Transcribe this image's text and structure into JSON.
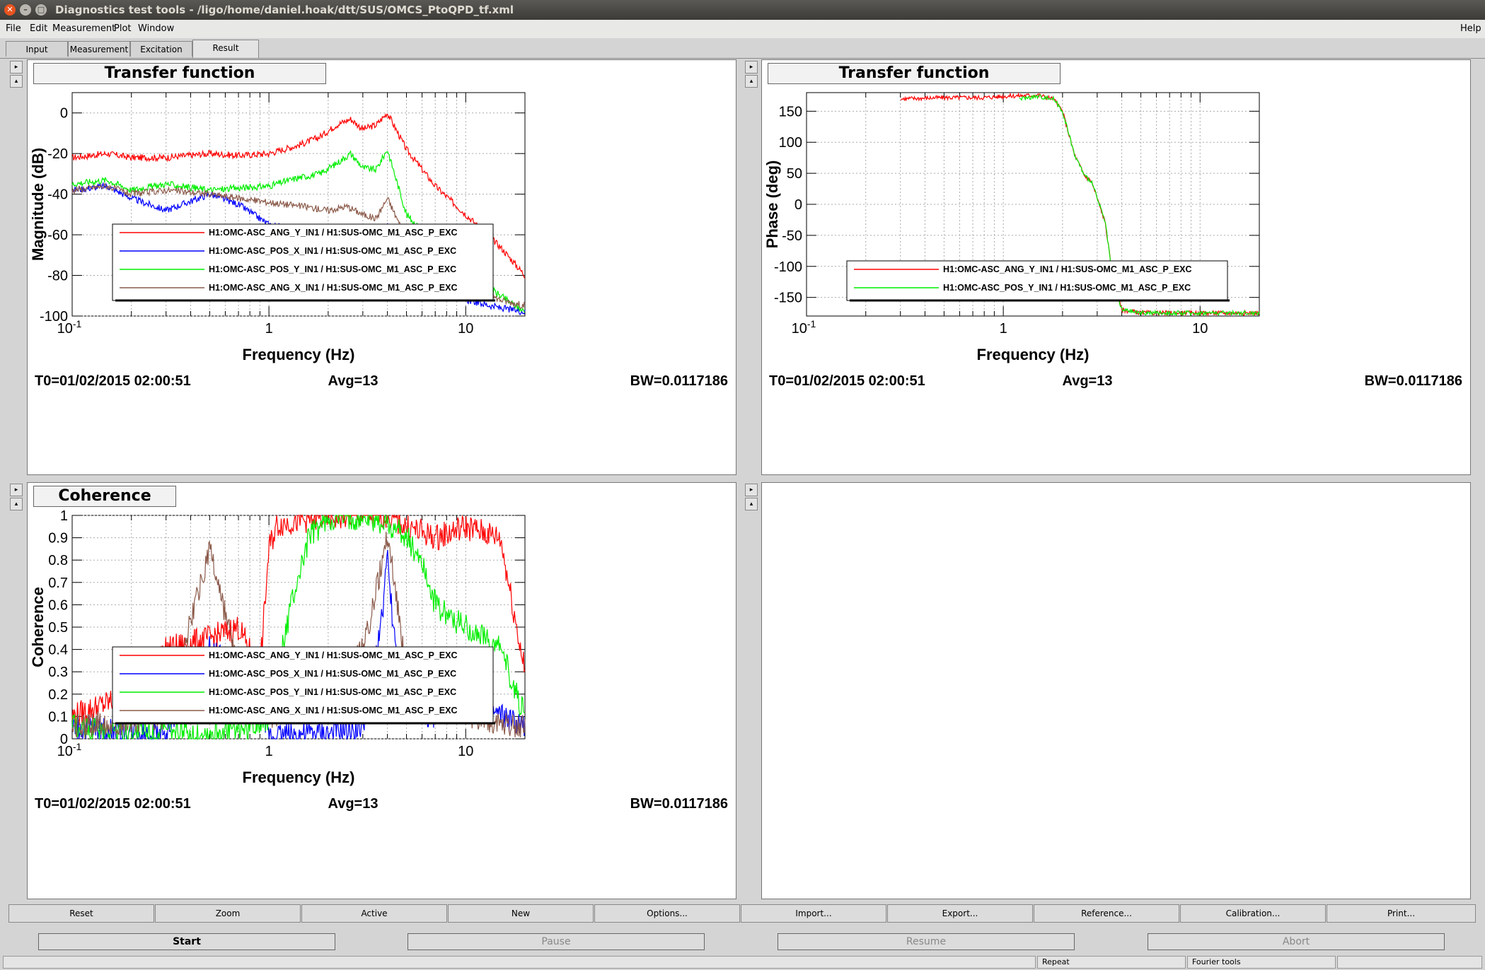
{
  "window": {
    "title": "Diagnostics test tools - /ligo/home/daniel.hoak/dtt/SUS/OMCS_PtoQPD_tf.xml",
    "buttons": [
      "close-icon",
      "minimize-icon",
      "maximize-icon"
    ]
  },
  "menu": {
    "left": [
      "File",
      "Edit",
      "Measurement",
      "Plot",
      "Window"
    ],
    "help": "Help"
  },
  "tabs": [
    "Input",
    "Measurement",
    "Excitation",
    "Result"
  ],
  "active_tab": "Result",
  "pads": {
    "tf_mag": {
      "header": "Transfer function",
      "xlabel": "Frequency (Hz)",
      "ylabel": "Magnitude (dB)",
      "t0": "T0=01/02/2015 02:00:51",
      "avg": "Avg=13",
      "bw": "BW=0.0117186",
      "legend": [
        "H1:OMC-ASC_ANG_Y_IN1 / H1:SUS-OMC_M1_ASC_P_EXC",
        "H1:OMC-ASC_POS_X_IN1 / H1:SUS-OMC_M1_ASC_P_EXC",
        "H1:OMC-ASC_POS_Y_IN1 / H1:SUS-OMC_M1_ASC_P_EXC",
        "H1:OMC-ASC_ANG_X_IN1 / H1:SUS-OMC_M1_ASC_P_EXC"
      ]
    },
    "tf_phase": {
      "header": "Transfer function",
      "xlabel": "Frequency (Hz)",
      "ylabel": "Phase (deg)",
      "t0": "T0=01/02/2015 02:00:51",
      "avg": "Avg=13",
      "bw": "BW=0.0117186",
      "legend": [
        "H1:OMC-ASC_ANG_Y_IN1 / H1:SUS-OMC_M1_ASC_P_EXC",
        "H1:OMC-ASC_POS_Y_IN1 / H1:SUS-OMC_M1_ASC_P_EXC"
      ]
    },
    "coherence": {
      "header": "Coherence",
      "xlabel": "Frequency (Hz)",
      "ylabel": "Coherence",
      "t0": "T0=01/02/2015 02:00:51",
      "avg": "Avg=13",
      "bw": "BW=0.0117186",
      "legend": [
        "H1:OMC-ASC_ANG_Y_IN1 / H1:SUS-OMC_M1_ASC_P_EXC",
        "H1:OMC-ASC_POS_X_IN1 / H1:SUS-OMC_M1_ASC_P_EXC",
        "H1:OMC-ASC_POS_Y_IN1 / H1:SUS-OMC_M1_ASC_P_EXC",
        "H1:OMC-ASC_ANG_X_IN1 / H1:SUS-OMC_M1_ASC_P_EXC"
      ]
    }
  },
  "toolbar": [
    "Reset",
    "Zoom",
    "Active",
    "New",
    "Options...",
    "Import...",
    "Export...",
    "Reference...",
    "Calibration...",
    "Print..."
  ],
  "controls": {
    "start": "Start",
    "pause": "Pause",
    "resume": "Resume",
    "abort": "Abort"
  },
  "status": {
    "repeat": "Repeat",
    "fourier": "Fourier tools"
  },
  "colors": {
    "red": "#ff0000",
    "blue": "#0000ff",
    "green": "#00ee00",
    "brown": "#8b5a4a"
  },
  "chart_data": [
    {
      "type": "line",
      "title": "Transfer function",
      "xlabel": "Frequency (Hz)",
      "ylabel": "Magnitude (dB)",
      "xscale": "log",
      "xlim": [
        0.1,
        20
      ],
      "ylim": [
        -100,
        10
      ],
      "xticks": [
        "10-1",
        "1",
        "10"
      ],
      "yticks": [
        0,
        -20,
        -40,
        -60,
        -80,
        -100
      ],
      "grid": true,
      "legend_position": "bottom-left",
      "series": [
        {
          "name": "H1:OMC-ASC_ANG_Y_IN1 / H1:SUS-OMC_M1_ASC_P_EXC",
          "color": "#ff0000",
          "x": [
            0.1,
            0.15,
            0.2,
            0.3,
            0.5,
            0.7,
            1.0,
            1.4,
            1.8,
            2.2,
            2.6,
            3.0,
            3.5,
            4.0,
            5,
            7,
            10,
            15,
            20
          ],
          "y": [
            -22,
            -20,
            -22,
            -22,
            -20,
            -21,
            -20,
            -16,
            -12,
            -6,
            -3,
            -8,
            -6,
            0,
            -18,
            -36,
            -50,
            -66,
            -80
          ]
        },
        {
          "name": "H1:OMC-ASC_POS_X_IN1 / H1:SUS-OMC_M1_ASC_P_EXC",
          "color": "#0000ff",
          "x": [
            0.1,
            0.15,
            0.2,
            0.3,
            0.5,
            0.7,
            1.0,
            1.5,
            2,
            2.5,
            3,
            3.5,
            4,
            5,
            7,
            10,
            15,
            20
          ],
          "y": [
            -38,
            -36,
            -42,
            -48,
            -40,
            -45,
            -55,
            -58,
            -60,
            -62,
            -66,
            -64,
            -56,
            -75,
            -86,
            -92,
            -96,
            -98
          ]
        },
        {
          "name": "H1:OMC-ASC_POS_Y_IN1 / H1:SUS-OMC_M1_ASC_P_EXC",
          "color": "#00ee00",
          "x": [
            0.1,
            0.15,
            0.2,
            0.3,
            0.5,
            0.7,
            1.0,
            1.4,
            1.8,
            2.2,
            2.6,
            3.0,
            3.5,
            4.0,
            5,
            7,
            10,
            15,
            20
          ],
          "y": [
            -35,
            -33,
            -38,
            -35,
            -38,
            -37,
            -36,
            -32,
            -30,
            -25,
            -20,
            -27,
            -28,
            -18,
            -50,
            -65,
            -78,
            -90,
            -98
          ]
        },
        {
          "name": "H1:OMC-ASC_ANG_X_IN1 / H1:SUS-OMC_M1_ASC_P_EXC",
          "color": "#8b5a4a",
          "x": [
            0.1,
            0.15,
            0.2,
            0.3,
            0.5,
            0.7,
            1.0,
            1.5,
            2,
            2.5,
            3,
            3.5,
            4,
            5,
            7,
            10,
            15,
            20
          ],
          "y": [
            -38,
            -36,
            -40,
            -38,
            -40,
            -42,
            -44,
            -46,
            -48,
            -46,
            -50,
            -52,
            -42,
            -62,
            -75,
            -85,
            -92,
            -95
          ]
        }
      ]
    },
    {
      "type": "line",
      "title": "Transfer function",
      "xlabel": "Frequency (Hz)",
      "ylabel": "Phase (deg)",
      "xscale": "log",
      "xlim": [
        0.1,
        20
      ],
      "ylim": [
        -180,
        180
      ],
      "xticks": [
        "10-1",
        "1",
        "10"
      ],
      "yticks": [
        150,
        100,
        50,
        0,
        -50,
        -100,
        -150
      ],
      "grid": true,
      "legend_position": "bottom-left",
      "series": [
        {
          "name": "H1:OMC-ASC_ANG_Y_IN1 / H1:SUS-OMC_M1_ASC_P_EXC",
          "color": "#ff0000",
          "x": [
            0.3,
            0.5,
            0.8,
            1.0,
            1.2,
            1.5,
            1.8,
            2.0,
            2.3,
            2.6,
            2.8,
            3.0,
            3.3,
            3.6,
            4.0,
            5.0
          ],
          "y": [
            170,
            172,
            172,
            174,
            175,
            176,
            170,
            150,
            80,
            45,
            38,
            10,
            -30,
            -120,
            -170,
            -175
          ]
        },
        {
          "name": "H1:OMC-ASC_POS_Y_IN1 / H1:SUS-OMC_M1_ASC_P_EXC",
          "color": "#00ee00",
          "x": [
            1.2,
            1.5,
            1.8,
            2.0,
            2.3,
            2.6,
            2.8,
            3.0,
            3.3,
            3.6,
            4.0,
            5.0
          ],
          "y": [
            170,
            174,
            170,
            150,
            80,
            45,
            38,
            10,
            -30,
            -120,
            -170,
            -175
          ]
        }
      ]
    },
    {
      "type": "line",
      "title": "Coherence",
      "xlabel": "Frequency (Hz)",
      "ylabel": "Coherence",
      "xscale": "log",
      "xlim": [
        0.1,
        20
      ],
      "ylim": [
        0,
        1
      ],
      "xticks": [
        "10-1",
        "1",
        "10"
      ],
      "yticks": [
        1,
        0.9,
        0.8,
        0.7,
        0.6,
        0.5,
        0.4,
        0.3,
        0.2,
        0.1,
        0
      ],
      "grid": true,
      "legend_position": "bottom-left",
      "series": [
        {
          "name": "H1:OMC-ASC_ANG_Y_IN1 / H1:SUS-OMC_M1_ASC_P_EXC",
          "color": "#ff0000",
          "x": [
            0.1,
            0.2,
            0.3,
            0.5,
            0.7,
            0.9,
            1.0,
            1.1,
            1.5,
            2,
            3,
            4,
            5,
            7,
            10,
            15,
            20
          ],
          "y": [
            0.1,
            0.2,
            0.4,
            0.45,
            0.5,
            0.3,
            0.85,
            0.96,
            0.98,
            0.99,
            1.0,
            1.0,
            0.95,
            0.9,
            0.95,
            0.9,
            0.3
          ]
        },
        {
          "name": "H1:OMC-ASC_POS_X_IN1 / H1:SUS-OMC_M1_ASC_P_EXC",
          "color": "#0000ff",
          "x": [
            0.1,
            0.3,
            0.5,
            0.7,
            1.0,
            2,
            3,
            3.7,
            4,
            4.5,
            5,
            7,
            10,
            15,
            20
          ],
          "y": [
            0.05,
            0.02,
            0.4,
            0.3,
            0.02,
            0.02,
            0.05,
            0.5,
            0.8,
            0.3,
            0.15,
            0.1,
            0.15,
            0.1,
            0.05
          ]
        },
        {
          "name": "H1:OMC-ASC_POS_Y_IN1 / H1:SUS-OMC_M1_ASC_P_EXC",
          "color": "#00ee00",
          "x": [
            0.1,
            0.5,
            0.8,
            1.0,
            1.3,
            1.6,
            2,
            3,
            4,
            5,
            6,
            7,
            10,
            15,
            20
          ],
          "y": [
            0.05,
            0.02,
            0.05,
            0.1,
            0.6,
            0.9,
            0.98,
            0.99,
            0.97,
            0.9,
            0.8,
            0.6,
            0.5,
            0.4,
            0.1
          ]
        },
        {
          "name": "H1:OMC-ASC_ANG_X_IN1 / H1:SUS-OMC_M1_ASC_P_EXC",
          "color": "#8b5a4a",
          "x": [
            0.1,
            0.3,
            0.5,
            0.7,
            1.0,
            2,
            3,
            3.6,
            4,
            4.5,
            5,
            7,
            10,
            20
          ],
          "y": [
            0.05,
            0.1,
            0.85,
            0.3,
            0.1,
            0.2,
            0.4,
            0.7,
            0.92,
            0.6,
            0.3,
            0.2,
            0.1,
            0.05
          ]
        }
      ]
    }
  ]
}
